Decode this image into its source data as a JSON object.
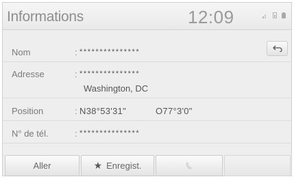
{
  "header": {
    "title": "Informations",
    "time": "12:09",
    "status_icons": [
      "signal-icon",
      "battery-icon",
      "lock-icon"
    ]
  },
  "fields": [
    {
      "label": "Nom",
      "colon": ":",
      "value": "***************",
      "masked": true
    },
    {
      "label": "Adresse",
      "colon": ":",
      "value": "***************",
      "value_line2": "Washington, DC",
      "masked": true
    },
    {
      "label": "Position",
      "colon": ":",
      "value": "N38°53'31\"",
      "value_extra": "O77°3'0\"",
      "masked": false
    },
    {
      "label": "N° de tél.",
      "colon": ":",
      "value": "***************",
      "masked": true
    }
  ],
  "back_button": {
    "icon": "back-arrow-icon"
  },
  "buttons": {
    "go": "Aller",
    "save": "Enregist.",
    "call_icon": "phone-icon"
  },
  "colors": {
    "background": "#eeeeee",
    "text": "#555555",
    "label": "#7a7a7a"
  }
}
